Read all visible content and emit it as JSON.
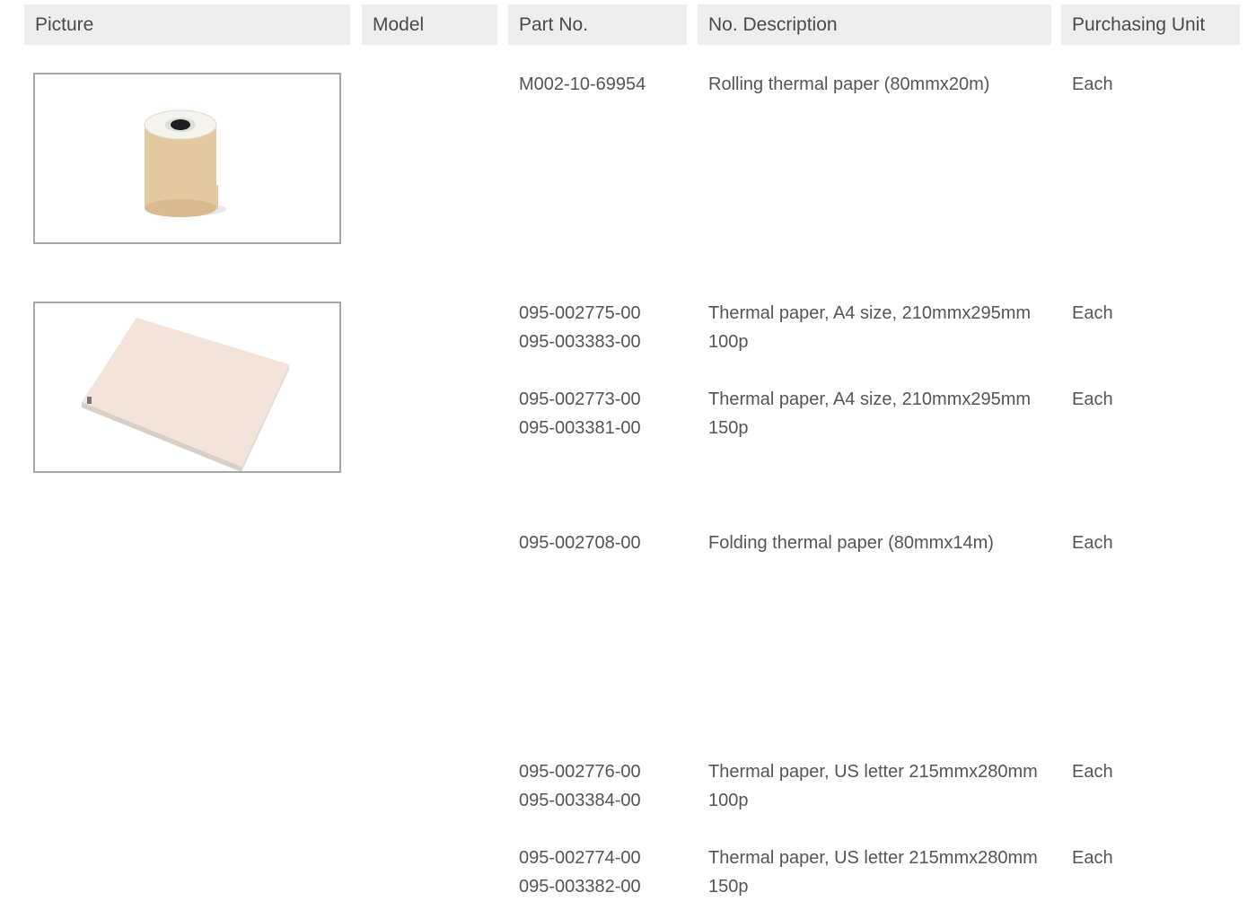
{
  "table": {
    "headers": {
      "picture": "Picture",
      "model": "Model",
      "part_no": "Part No.",
      "description": "No. Description",
      "purchasing_unit": "Purchasing Unit"
    },
    "rows": [
      {
        "picture": "rolling-thermal-paper-roll",
        "model": "",
        "part_no": [
          "M002-10-69954"
        ],
        "description": [
          "Rolling thermal paper (80mmx20m)"
        ],
        "unit": "Each"
      },
      {
        "picture": "a4-thermal-paper-stack",
        "model": "",
        "part_no": [
          "095-002775-00",
          "095-003383-00"
        ],
        "description": [
          "Thermal paper, A4 size, 210mmx295mm",
          "100p"
        ],
        "unit": "Each"
      },
      {
        "picture": "",
        "model": "",
        "part_no": [
          "095-002773-00",
          "095-003381-00"
        ],
        "description": [
          "Thermal paper, A4 size, 210mmx295mm",
          "150p"
        ],
        "unit": "Each"
      },
      {
        "picture": "",
        "model": "",
        "part_no": [
          "095-002708-00"
        ],
        "description": [
          "Folding thermal paper (80mmx14m)"
        ],
        "unit": "Each"
      },
      {
        "picture": "",
        "model": "",
        "part_no": [
          "095-002776-00",
          "095-003384-00"
        ],
        "description": [
          "Thermal paper, US letter 215mmx280mm",
          "100p"
        ],
        "unit": "Each"
      },
      {
        "picture": "",
        "model": "",
        "part_no": [
          "095-002774-00",
          "095-003382-00"
        ],
        "description": [
          "Thermal paper, US letter 215mmx280mm",
          "150p"
        ],
        "unit": "Each"
      }
    ]
  }
}
